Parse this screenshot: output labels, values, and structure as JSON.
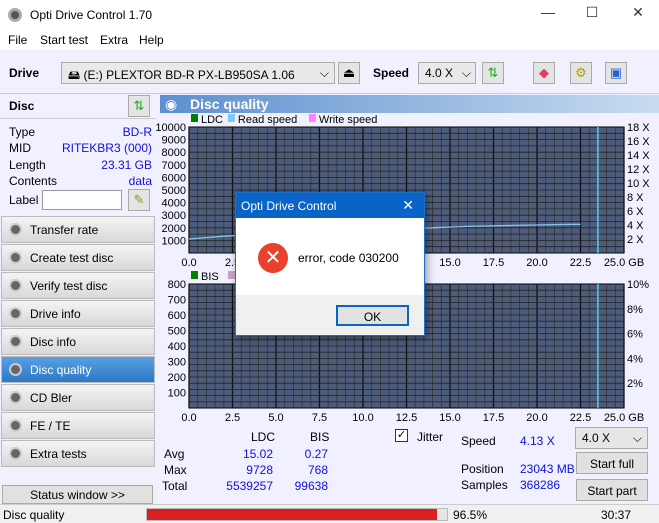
{
  "window": {
    "title": "Opti Drive Control 1.70",
    "minimize": "—",
    "maximize": "☐",
    "close": "✕"
  },
  "menu": [
    "File",
    "Start test",
    "Extra",
    "Help"
  ],
  "toolbar": {
    "drive_label": "Drive",
    "drive_value": "(E:)   PLEXTOR BD-R  PX-LB950SA 1.06",
    "speed_label": "Speed",
    "speed_value": "4.0 X"
  },
  "disc": {
    "title": "Disc",
    "type_label": "Type",
    "type": "BD-R",
    "mid_label": "MID",
    "mid": "RITEKBR3 (000)",
    "length_label": "Length",
    "length": "23.31 GB",
    "contents_label": "Contents",
    "contents": "data",
    "label_label": "Label",
    "label_value": ""
  },
  "nav": [
    {
      "label": "Transfer rate"
    },
    {
      "label": "Create test disc"
    },
    {
      "label": "Verify test disc"
    },
    {
      "label": "Drive info"
    },
    {
      "label": "Disc info"
    },
    {
      "label": "Disc quality",
      "active": true
    },
    {
      "label": "CD Bler"
    },
    {
      "label": "FE / TE"
    },
    {
      "label": "Extra tests"
    }
  ],
  "status_window": "Status window >>",
  "panel_title": "Disc quality",
  "chart_data": [
    {
      "type": "line",
      "legend": [
        "LDC",
        "Read speed",
        "Write speed"
      ],
      "legend_colors": [
        "#008000",
        "#80c8f0",
        "#ff80ff"
      ],
      "x_ticks": [
        "0.0",
        "2.5",
        "5.0",
        "7.5",
        "10.0",
        "12.5",
        "15.0",
        "17.5",
        "20.0",
        "22.5",
        "25.0 GB"
      ],
      "xlim": [
        0,
        25
      ],
      "y_ticks": [
        "1000",
        "2000",
        "3000",
        "4000",
        "5000",
        "6000",
        "7000",
        "8000",
        "9000",
        "10000"
      ],
      "ylim": [
        0,
        10000
      ],
      "y2_ticks": [
        "2 X",
        "4 X",
        "6 X",
        "8 X",
        "10 X",
        "12 X",
        "14 X",
        "16 X",
        "18 X"
      ],
      "y2lim": [
        0,
        18
      ],
      "series": [
        {
          "name": "Read speed",
          "x": [
            0,
            1,
            2,
            4,
            6,
            8,
            10,
            12,
            14,
            16,
            18,
            20,
            22,
            22.5
          ],
          "y": [
            2.0,
            2.2,
            2.4,
            2.7,
            2.9,
            3.1,
            3.3,
            3.4,
            3.6,
            3.8,
            3.9,
            4.0,
            4.1,
            4.1
          ]
        }
      ],
      "marker_x": 23.5
    },
    {
      "type": "line",
      "legend": [
        "BIS",
        "Jitter"
      ],
      "legend_colors": [
        "#008000",
        "#d0a0d0"
      ],
      "x_ticks": [
        "0.0",
        "2.5",
        "5.0",
        "7.5",
        "10.0",
        "12.5",
        "15.0",
        "17.5",
        "20.0",
        "22.5",
        "25.0 GB"
      ],
      "xlim": [
        0,
        25
      ],
      "y_ticks": [
        "100",
        "200",
        "300",
        "400",
        "500",
        "600",
        "700",
        "800"
      ],
      "ylim": [
        0,
        800
      ],
      "y2_ticks": [
        "2%",
        "4%",
        "6%",
        "8%",
        "10%"
      ],
      "y2lim": [
        0,
        10
      ],
      "marker_x": 23.5
    }
  ],
  "stats": {
    "col_ldc": "LDC",
    "col_bis": "BIS",
    "avg_label": "Avg",
    "avg_ldc": "15.02",
    "avg_bis": "0.27",
    "max_label": "Max",
    "max_ldc": "9728",
    "max_bis": "768",
    "total_label": "Total",
    "total_ldc": "5539257",
    "total_bis": "99638",
    "jitter_label": "Jitter",
    "jitter_checked": true,
    "speed_label": "Speed",
    "speed": "4.13 X",
    "position_label": "Position",
    "position": "23043 MB",
    "samples_label": "Samples",
    "samples": "368286",
    "speed_select": "4.0 X",
    "start_full": "Start full",
    "start_part": "Start part"
  },
  "dialog": {
    "title": "Opti Drive Control",
    "message": "error, code 030200",
    "ok": "OK",
    "close": "✕"
  },
  "statusbar": {
    "text": "Disc quality",
    "progress": 96.5,
    "progress_text": "96.5%",
    "time": "30:37",
    "progress_color": "#d82020"
  }
}
